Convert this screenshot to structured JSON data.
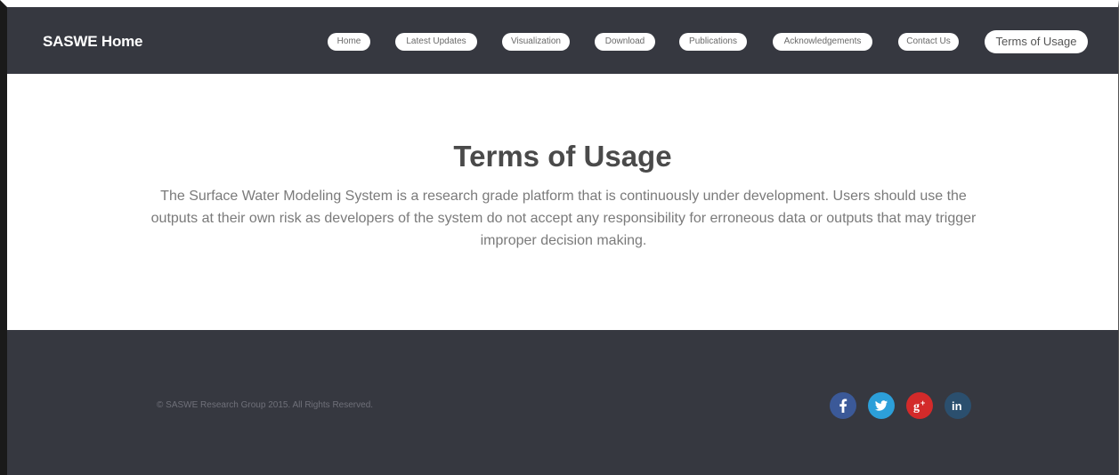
{
  "brand": "SASWE Home",
  "nav": {
    "items": [
      {
        "label": "Home"
      },
      {
        "label": "Latest Updates"
      },
      {
        "label": "Visualization"
      },
      {
        "label": "Download"
      },
      {
        "label": "Publications"
      },
      {
        "label": "Acknowledgements"
      },
      {
        "label": "Contact Us"
      },
      {
        "label": "Terms of Usage"
      }
    ],
    "active": "Terms of Usage"
  },
  "main": {
    "title": "Terms of Usage",
    "body": "The Surface Water Modeling System is a research grade platform that is continuously under development. Users should use the outputs at their own risk as developers of the system do not accept any responsibility for erroneous data or outputs that may trigger improper decision making."
  },
  "footer": {
    "copyright": "© SASWE Research Group 2015. All Rights Reserved.",
    "social": [
      {
        "icon": "facebook-icon",
        "glyph": "f",
        "color": "#3b5998"
      },
      {
        "icon": "twitter-icon",
        "glyph": "t",
        "color": "#2c9fd9"
      },
      {
        "icon": "google-plus-icon",
        "glyph": "g+",
        "color": "#d32a2a"
      },
      {
        "icon": "linkedin-icon",
        "glyph": "in",
        "color": "#2b4f6e"
      }
    ]
  },
  "colors": {
    "navbar_bg": "#363840",
    "footer_bg": "#363840",
    "pill_bg": "#ffffff"
  }
}
